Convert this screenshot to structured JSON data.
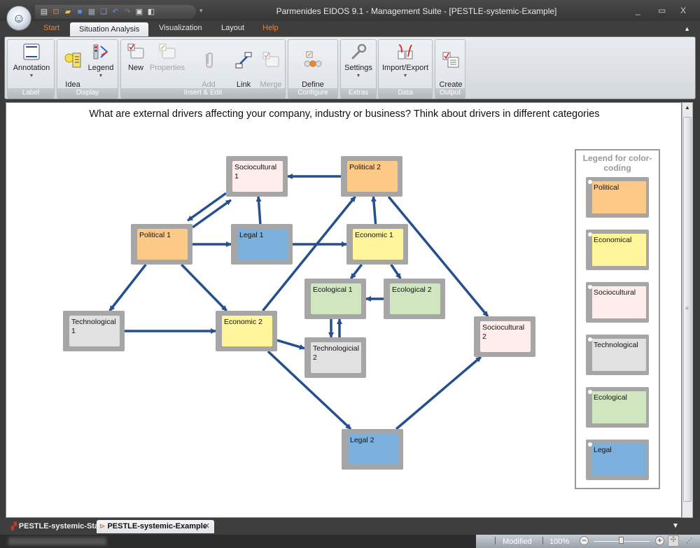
{
  "window": {
    "title": "Parmenides EIDOS 9.1 - Management Suite - [PESTLE-systemic-Example]",
    "controls": {
      "minimize": "_",
      "maximize": "▭",
      "close": "X"
    }
  },
  "quick_access": [
    "new-doc-icon",
    "new-map-icon",
    "open-folder-icon",
    "save-icon",
    "print-preview-icon",
    "copy-icon",
    "undo-icon",
    "redo-icon",
    "fit-icon",
    "export-icon"
  ],
  "ribbon_tabs": [
    {
      "label": "Start",
      "state": "normal",
      "color": "#e8803a"
    },
    {
      "label": "Situation Analysis",
      "state": "active"
    },
    {
      "label": "Visualization",
      "state": "normal"
    },
    {
      "label": "Layout",
      "state": "normal"
    },
    {
      "label": "Help",
      "state": "normal",
      "color": "#e8803a"
    }
  ],
  "ribbon_groups": {
    "label": {
      "name": "Label",
      "buttons": {
        "annotation": "Annotation"
      }
    },
    "display": {
      "name": "Display",
      "buttons": {
        "idea_list": "Idea\nlist",
        "legend": "Legend"
      }
    },
    "insert_edit": {
      "name": "Insert & Edit",
      "buttons": {
        "new": "New",
        "properties": "Properties",
        "add_attachment": "Add\nAttachment",
        "link_mode": "Link\nMode",
        "merge_boxes": "Merge\nBoxes"
      }
    },
    "configure": {
      "name": "Configure",
      "buttons": {
        "define_perspectives": "Define\nPerspectives"
      }
    },
    "extras": {
      "name": "Extras",
      "buttons": {
        "settings": "Settings"
      }
    },
    "data": {
      "name": "Data",
      "buttons": {
        "import_export": "Import/Export"
      }
    },
    "output": {
      "name": "Output",
      "buttons": {
        "create_slides": "Create\nSlides"
      }
    }
  },
  "canvas": {
    "question": "What are external drivers affecting your company, industry or business? Think about drivers in different categories"
  },
  "categories": {
    "political": {
      "label": "Political",
      "color": "#fdc987"
    },
    "economical": {
      "label": "Economical",
      "color": "#fff59a"
    },
    "sociocultural": {
      "label": "Sociocultural",
      "color": "#ffecec"
    },
    "technological": {
      "label": "Technological",
      "color": "#e1e1e1"
    },
    "ecological": {
      "label": "Ecological",
      "color": "#cfe6bf"
    },
    "legal": {
      "label": "Legal",
      "color": "#7bb0dc"
    }
  },
  "nodes": [
    {
      "id": "soc1",
      "label": "Sociocultural 1",
      "category": "sociocultural"
    },
    {
      "id": "pol2",
      "label": "Political 2",
      "category": "political"
    },
    {
      "id": "pol1",
      "label": "Political 1",
      "category": "political"
    },
    {
      "id": "leg1",
      "label": "Legal 1",
      "category": "legal"
    },
    {
      "id": "eco1",
      "label": "Economic 1",
      "category": "economical"
    },
    {
      "id": "ecol1",
      "label": "Ecological 1",
      "category": "ecological"
    },
    {
      "id": "ecol2",
      "label": "Ecological 2",
      "category": "ecological"
    },
    {
      "id": "tech1",
      "label": "Technological 1",
      "category": "technological"
    },
    {
      "id": "eco2",
      "label": "Economic 2",
      "category": "economical"
    },
    {
      "id": "tech2",
      "label": "Technologicial 2",
      "category": "technological"
    },
    {
      "id": "soc2",
      "label": "Sociocultural 2",
      "category": "sociocultural"
    },
    {
      "id": "leg2",
      "label": "Legal 2",
      "category": "legal"
    }
  ],
  "links": [
    {
      "from": "pol2",
      "to": "soc1"
    },
    {
      "from": "pol1",
      "to": "soc1"
    },
    {
      "from": "soc1",
      "to": "pol1"
    },
    {
      "from": "leg1",
      "to": "soc1"
    },
    {
      "from": "pol1",
      "to": "leg1"
    },
    {
      "from": "leg1",
      "to": "eco1"
    },
    {
      "from": "eco1",
      "to": "pol2"
    },
    {
      "from": "eco2",
      "to": "pol2"
    },
    {
      "from": "pol2",
      "to": "soc2"
    },
    {
      "from": "pol1",
      "to": "tech1"
    },
    {
      "from": "pol1",
      "to": "eco2"
    },
    {
      "from": "eco1",
      "to": "ecol1"
    },
    {
      "from": "eco1",
      "to": "ecol2"
    },
    {
      "from": "ecol2",
      "to": "ecol1"
    },
    {
      "from": "tech2",
      "to": "ecol1"
    },
    {
      "from": "ecol1",
      "to": "tech2"
    },
    {
      "from": "tech1",
      "to": "eco2"
    },
    {
      "from": "eco2",
      "to": "tech2"
    },
    {
      "from": "eco2",
      "to": "leg2"
    },
    {
      "from": "leg2",
      "to": "soc2"
    }
  ],
  "link_color": "#254f8e",
  "legend": {
    "title": "Legend for color-coding",
    "items": [
      "political",
      "economical",
      "sociocultural",
      "technological",
      "ecological",
      "legal"
    ]
  },
  "document_tabs": [
    {
      "label": "PESTLE-systemic-Start",
      "active": false
    },
    {
      "label": "PESTLE-systemic-Example",
      "active": true
    }
  ],
  "status": {
    "state": "Modified",
    "zoom": "100%",
    "zoom_slider_fraction": 0.5
  }
}
